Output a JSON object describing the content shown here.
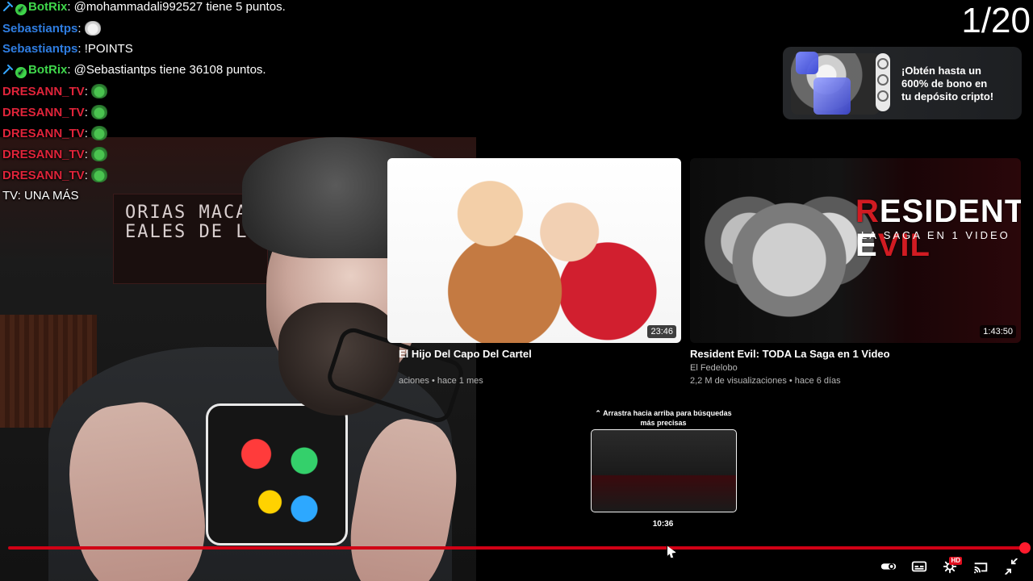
{
  "overlay": {
    "counter": "1/20",
    "chat": [
      {
        "user": "BotRix",
        "user_color": "#3fd64b",
        "badges": [
          "sword",
          "check"
        ],
        "message": ": @mohammadali992527 tiene 5 puntos."
      },
      {
        "user": "Sebastiantps",
        "user_color": "#2f7de1",
        "badges": [],
        "message": ": ",
        "emote": "cat"
      },
      {
        "user": "Sebastiantps",
        "user_color": "#2f7de1",
        "badges": [],
        "message": ": !POINTS"
      },
      {
        "user": "BotRix",
        "user_color": "#3fd64b",
        "badges": [
          "sword",
          "check"
        ],
        "message": ": @Sebastiantps tiene 36108 puntos."
      },
      {
        "user": "DRESANN_TV",
        "user_color": "#e0243a",
        "badges": [],
        "message": ": ",
        "emote": "pepe"
      },
      {
        "user": "DRESANN_TV",
        "user_color": "#e0243a",
        "badges": [],
        "message": ": ",
        "emote": "pepe"
      },
      {
        "user": "DRESANN_TV",
        "user_color": "#e0243a",
        "badges": [],
        "message": ": ",
        "emote": "pepe"
      },
      {
        "user": "DRESANN_TV",
        "user_color": "#e0243a",
        "badges": [],
        "message": ": ",
        "emote": "pepe"
      },
      {
        "user": "DRESANN_TV",
        "user_color": "#e0243a",
        "badges": [],
        "message": ": ",
        "emote": "pepe"
      },
      {
        "user": "",
        "user_color": "#e0243a",
        "badges": [],
        "message": "TV: UNA MÁS"
      }
    ],
    "webcam_sign": [
      "ORIAS MACAB",
      "EALES DE LA"
    ]
  },
  "promo": {
    "text": "¡Obtén hasta un 600% de bono en tu depósito cripto!"
  },
  "videos": [
    {
      "title": "El Hijo Del Capo Del Cartel",
      "channel": "",
      "meta": "aciones • hace 1 mes",
      "duration": "23:46"
    },
    {
      "title": "Resident Evil: TODA La Saga en 1 Video",
      "channel": "El Fedelobo",
      "meta": "2,2 M de visualizaciones • hace 6 días",
      "duration": "1:43:50",
      "thumb_logo": {
        "line1a": "R",
        "line1b": "ESIDENT E",
        "line1c": "VIL",
        "line2": "LA SAGA EN 1 VIDEO"
      }
    }
  ],
  "preview": {
    "hint": "⌃ Arrastra hacia arriba para búsquedas más precisas",
    "time": "10:36"
  },
  "player": {
    "accent": "#ff1b2d",
    "hd_badge": "HD"
  }
}
